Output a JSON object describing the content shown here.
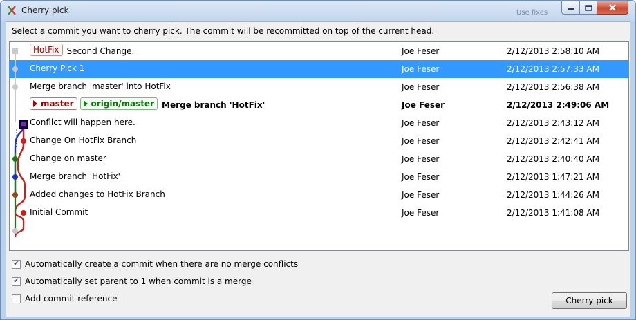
{
  "window": {
    "title": "Cherry pick",
    "ghost_text": "Use fixes",
    "buttons": [
      "minimize",
      "maximize",
      "close"
    ]
  },
  "instruction": "Select a commit you want to cherry pick. The commit will be recommitted on top of the current head.",
  "commits": [
    {
      "tags": [
        {
          "text": "HotFix",
          "kind": "tag"
        }
      ],
      "message": "Second Change.",
      "author": "Joe Feser",
      "date": "2/12/2013 2:58:10 AM",
      "selected": false,
      "bold": false
    },
    {
      "tags": [],
      "message": "Cherry Pick 1",
      "author": "Joe Feser",
      "date": "2/12/2013 2:57:33 AM",
      "selected": true,
      "bold": false
    },
    {
      "tags": [],
      "message": "Merge branch 'master' into HotFix",
      "author": "Joe Feser",
      "date": "2/12/2013 2:56:38 AM",
      "selected": false,
      "bold": false
    },
    {
      "tags": [
        {
          "text": "master",
          "kind": "branch"
        },
        {
          "text": "origin/master",
          "kind": "remote"
        }
      ],
      "message": "Merge branch 'HotFix'",
      "author": "Joe Feser",
      "date": "2/12/2013 2:49:06 AM",
      "selected": false,
      "bold": true
    },
    {
      "tags": [],
      "message": "Conflict will happen here.",
      "author": "Joe Feser",
      "date": "2/12/2013 2:43:12 AM",
      "selected": false,
      "bold": false
    },
    {
      "tags": [],
      "message": "Change On HotFix Branch",
      "author": "Joe Feser",
      "date": "2/12/2013 2:42:41 AM",
      "selected": false,
      "bold": false
    },
    {
      "tags": [],
      "message": "Change on master",
      "author": "Joe Feser",
      "date": "2/12/2013 2:40:40 AM",
      "selected": false,
      "bold": false
    },
    {
      "tags": [],
      "message": "Merge branch 'HotFix'",
      "author": "Joe Feser",
      "date": "2/12/2013 1:47:21 AM",
      "selected": false,
      "bold": false
    },
    {
      "tags": [],
      "message": "Added changes to HotFix Branch",
      "author": "Joe Feser",
      "date": "2/12/2013 1:44:26 AM",
      "selected": false,
      "bold": false
    },
    {
      "tags": [],
      "message": "Initial Commit",
      "author": "Joe Feser",
      "date": "2/12/2013 1:41:08 AM",
      "selected": false,
      "bold": false
    }
  ],
  "options": [
    {
      "label": "Automatically create a commit  when there are no merge conflicts",
      "checked": true
    },
    {
      "label": "Automatically set parent to 1 when commit is a merge",
      "checked": true
    },
    {
      "label": "Add commit reference",
      "checked": false
    }
  ],
  "cherry_pick_button": "Cherry pick",
  "colors": {
    "selection": "#3399ff",
    "graph_red": "#d21b1b",
    "graph_green": "#1a7a1a",
    "graph_blue": "#1c2fd0",
    "graph_gray": "#c8c8c8"
  }
}
